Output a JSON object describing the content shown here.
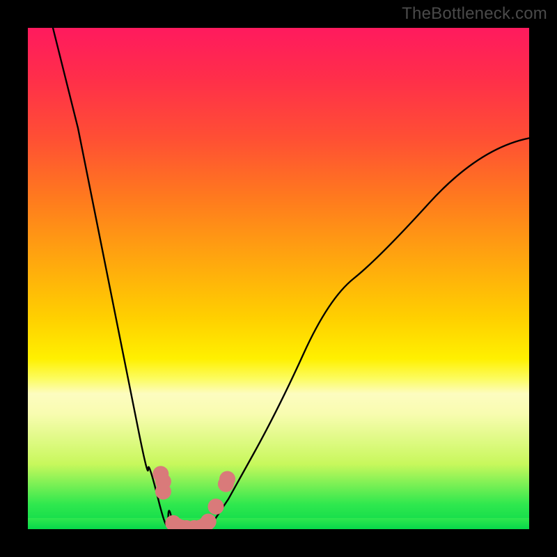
{
  "watermark": {
    "text": "TheBottleneck.com"
  },
  "chart_data": {
    "type": "line",
    "title": "",
    "xlabel": "",
    "ylabel": "",
    "xlim": [
      0,
      100
    ],
    "ylim": [
      0,
      100
    ],
    "grid": false,
    "legend": false,
    "background_gradient": {
      "top": "#ff1a5e",
      "upper_mid": "#ff7a1e",
      "mid": "#fff000",
      "lower_mid": "#fdfcc0",
      "bottom": "#06d84a"
    },
    "series": [
      {
        "name": "left-branch",
        "x": [
          5,
          10,
          15,
          20,
          22,
          24,
          26,
          28,
          29,
          30
        ],
        "y": [
          100,
          80,
          55,
          30,
          20,
          12,
          6,
          2,
          0.5,
          0
        ],
        "stroke": "#000000"
      },
      {
        "name": "valley-floor",
        "x": [
          30,
          32,
          34,
          36
        ],
        "y": [
          0,
          0,
          0,
          0
        ],
        "stroke": "#000000"
      },
      {
        "name": "right-branch",
        "x": [
          36,
          40,
          45,
          55,
          65,
          80,
          100
        ],
        "y": [
          0,
          6,
          15,
          35,
          50,
          65,
          78
        ],
        "stroke": "#000000"
      }
    ],
    "markers": [
      {
        "x": 26.5,
        "y": 11,
        "r": 1.6,
        "color": "#d97a7a"
      },
      {
        "x": 27.0,
        "y": 9.5,
        "r": 1.6,
        "color": "#d97a7a"
      },
      {
        "x": 27.0,
        "y": 7.5,
        "r": 1.6,
        "color": "#d97a7a"
      },
      {
        "x": 29.0,
        "y": 1.2,
        "r": 1.6,
        "color": "#d97a7a"
      },
      {
        "x": 29.8,
        "y": 0.6,
        "r": 1.6,
        "color": "#d97a7a"
      },
      {
        "x": 30.6,
        "y": 0.3,
        "r": 1.6,
        "color": "#d97a7a"
      },
      {
        "x": 31.6,
        "y": 0.2,
        "r": 1.6,
        "color": "#d97a7a"
      },
      {
        "x": 33.2,
        "y": 0.2,
        "r": 1.6,
        "color": "#d97a7a"
      },
      {
        "x": 34.4,
        "y": 0.3,
        "r": 1.6,
        "color": "#d97a7a"
      },
      {
        "x": 35.4,
        "y": 0.8,
        "r": 1.6,
        "color": "#d97a7a"
      },
      {
        "x": 36.0,
        "y": 1.5,
        "r": 1.6,
        "color": "#d97a7a"
      },
      {
        "x": 37.5,
        "y": 4.5,
        "r": 1.6,
        "color": "#d97a7a"
      },
      {
        "x": 39.5,
        "y": 9.0,
        "r": 1.6,
        "color": "#d97a7a"
      },
      {
        "x": 39.8,
        "y": 10.0,
        "r": 1.6,
        "color": "#d97a7a"
      }
    ]
  }
}
